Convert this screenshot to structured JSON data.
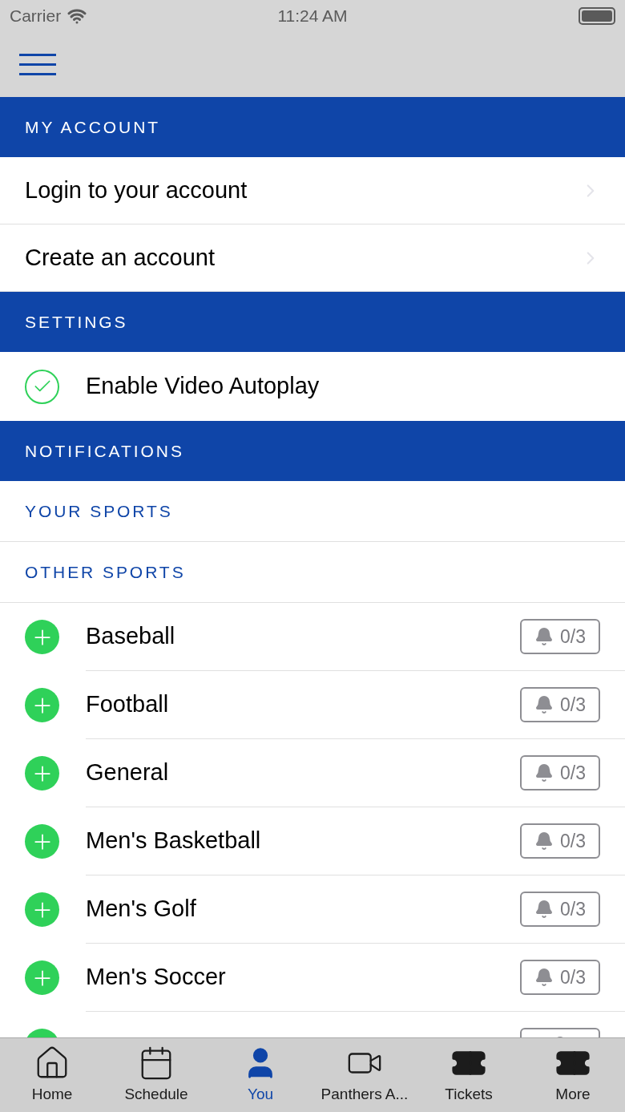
{
  "status_bar": {
    "carrier": "Carrier",
    "time": "11:24 AM"
  },
  "sections": [
    {
      "kind": "links",
      "title": "MY ACCOUNT",
      "items": [
        {
          "label": "Login to your account"
        },
        {
          "label": "Create an account"
        }
      ]
    },
    {
      "kind": "toggles",
      "title": "SETTINGS",
      "items": [
        {
          "label": "Enable Video Autoplay",
          "checked": true
        }
      ]
    },
    {
      "kind": "notifications",
      "title": "NOTIFICATIONS",
      "subheaders": [
        "YOUR SPORTS",
        "OTHER SPORTS"
      ],
      "sports": [
        {
          "label": "Baseball",
          "count": "0/3"
        },
        {
          "label": "Football",
          "count": "0/3"
        },
        {
          "label": "General",
          "count": "0/3"
        },
        {
          "label": "Men's Basketball",
          "count": "0/3"
        },
        {
          "label": "Men's Golf",
          "count": "0/3"
        },
        {
          "label": "Men's Soccer",
          "count": "0/3"
        },
        {
          "kind": "partial"
        }
      ]
    }
  ],
  "tab_bar": [
    {
      "label": "Home",
      "selected": false
    },
    {
      "label": "Schedule",
      "selected": false
    },
    {
      "label": "You",
      "selected": true
    },
    {
      "label": "Panthers A...",
      "selected": false
    },
    {
      "label": "Tickets",
      "selected": false
    },
    {
      "label": "More",
      "selected": false
    }
  ]
}
